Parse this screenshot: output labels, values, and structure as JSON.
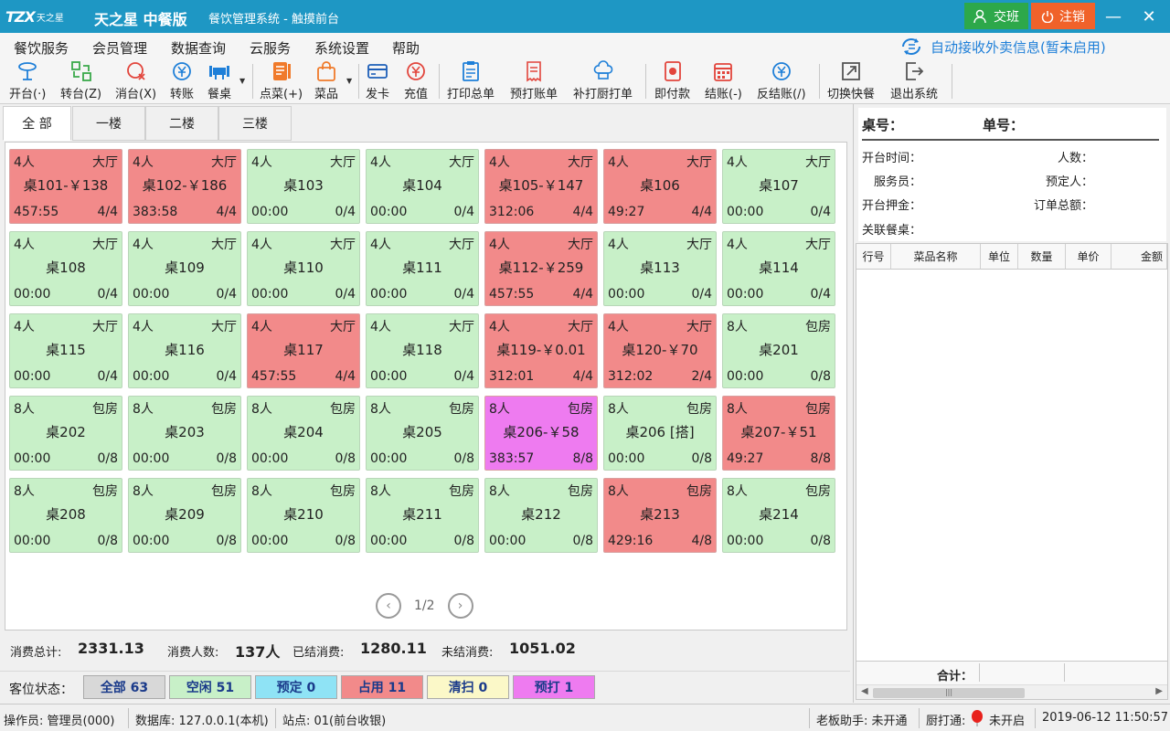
{
  "titlebar": {
    "logo_mark": "TZX",
    "logo_text": "天之星",
    "app_title": "天之星 中餐版",
    "window_title": "餐饮管理系统 - 触摸前台",
    "shift_label": "交班",
    "logout_label": "注销",
    "minimize_glyph": "—",
    "close_glyph": "✕"
  },
  "menu": {
    "items": [
      "餐饮服务",
      "会员管理",
      "数据查询",
      "云服务",
      "系统设置",
      "帮助"
    ],
    "auto_receive": "自动接收外卖信息(暂未启用)"
  },
  "toolbar": {
    "tools": [
      {
        "label": "开台(·)",
        "icon": "open-table-icon"
      },
      {
        "label": "转台(Z)",
        "icon": "transfer-table-icon"
      },
      {
        "label": "消台(X)",
        "icon": "cancel-table-icon"
      },
      {
        "label": "转账",
        "icon": "transfer-bill-icon"
      },
      {
        "label": "餐桌",
        "icon": "dining-table-icon"
      },
      {
        "label": "点菜(+)",
        "icon": "order-dish-icon"
      },
      {
        "label": "菜品",
        "icon": "dishes-bag-icon"
      },
      {
        "label": "发卡",
        "icon": "issue-card-icon"
      },
      {
        "label": "充值",
        "icon": "recharge-icon"
      },
      {
        "label": "打印总单",
        "icon": "print-total-icon"
      },
      {
        "label": "预打账单",
        "icon": "preprint-bill-icon"
      },
      {
        "label": "补打厨打单",
        "icon": "reprint-kitchen-icon"
      },
      {
        "label": "即付款",
        "icon": "instant-pay-icon"
      },
      {
        "label": "结账(-)",
        "icon": "checkout-icon"
      },
      {
        "label": "反结账(/)",
        "icon": "reverse-checkout-icon"
      },
      {
        "label": "切换快餐",
        "icon": "switch-fastfood-icon"
      },
      {
        "label": "退出系统",
        "icon": "exit-icon"
      }
    ]
  },
  "tabs": [
    "全 部",
    "一楼",
    "二楼",
    "三楼"
  ],
  "colors": {
    "free": "#c8f0c8",
    "occupied": "#f28a8a",
    "preprint": "#ee7bf0",
    "reserved": "#8fe3f5",
    "cleaning": "#fbf8c8",
    "all": "#d8d8d8",
    "accent": "#1e97c4"
  },
  "tables": [
    {
      "cap": "4人",
      "area": "大厅",
      "name": "桌101-￥138",
      "time": "457:55",
      "occ": "4/4",
      "status": "occupied"
    },
    {
      "cap": "4人",
      "area": "大厅",
      "name": "桌102-￥186",
      "time": "383:58",
      "occ": "4/4",
      "status": "occupied"
    },
    {
      "cap": "4人",
      "area": "大厅",
      "name": "桌103",
      "time": "00:00",
      "occ": "0/4",
      "status": "free"
    },
    {
      "cap": "4人",
      "area": "大厅",
      "name": "桌104",
      "time": "00:00",
      "occ": "0/4",
      "status": "free"
    },
    {
      "cap": "4人",
      "area": "大厅",
      "name": "桌105-￥147",
      "time": "312:06",
      "occ": "4/4",
      "status": "occupied"
    },
    {
      "cap": "4人",
      "area": "大厅",
      "name": "桌106",
      "time": "49:27",
      "occ": "4/4",
      "status": "occupied"
    },
    {
      "cap": "4人",
      "area": "大厅",
      "name": "桌107",
      "time": "00:00",
      "occ": "0/4",
      "status": "free"
    },
    {
      "cap": "4人",
      "area": "大厅",
      "name": "桌108",
      "time": "00:00",
      "occ": "0/4",
      "status": "free"
    },
    {
      "cap": "4人",
      "area": "大厅",
      "name": "桌109",
      "time": "00:00",
      "occ": "0/4",
      "status": "free"
    },
    {
      "cap": "4人",
      "area": "大厅",
      "name": "桌110",
      "time": "00:00",
      "occ": "0/4",
      "status": "free"
    },
    {
      "cap": "4人",
      "area": "大厅",
      "name": "桌111",
      "time": "00:00",
      "occ": "0/4",
      "status": "free"
    },
    {
      "cap": "4人",
      "area": "大厅",
      "name": "桌112-￥259",
      "time": "457:55",
      "occ": "4/4",
      "status": "occupied"
    },
    {
      "cap": "4人",
      "area": "大厅",
      "name": "桌113",
      "time": "00:00",
      "occ": "0/4",
      "status": "free"
    },
    {
      "cap": "4人",
      "area": "大厅",
      "name": "桌114",
      "time": "00:00",
      "occ": "0/4",
      "status": "free"
    },
    {
      "cap": "4人",
      "area": "大厅",
      "name": "桌115",
      "time": "00:00",
      "occ": "0/4",
      "status": "free"
    },
    {
      "cap": "4人",
      "area": "大厅",
      "name": "桌116",
      "time": "00:00",
      "occ": "0/4",
      "status": "free"
    },
    {
      "cap": "4人",
      "area": "大厅",
      "name": "桌117",
      "time": "457:55",
      "occ": "4/4",
      "status": "occupied"
    },
    {
      "cap": "4人",
      "area": "大厅",
      "name": "桌118",
      "time": "00:00",
      "occ": "0/4",
      "status": "free"
    },
    {
      "cap": "4人",
      "area": "大厅",
      "name": "桌119-￥0.01",
      "time": "312:01",
      "occ": "4/4",
      "status": "occupied"
    },
    {
      "cap": "4人",
      "area": "大厅",
      "name": "桌120-￥70",
      "time": "312:02",
      "occ": "2/4",
      "status": "occupied"
    },
    {
      "cap": "8人",
      "area": "包房",
      "name": "桌201",
      "time": "00:00",
      "occ": "0/8",
      "status": "free"
    },
    {
      "cap": "8人",
      "area": "包房",
      "name": "桌202",
      "time": "00:00",
      "occ": "0/8",
      "status": "free"
    },
    {
      "cap": "8人",
      "area": "包房",
      "name": "桌203",
      "time": "00:00",
      "occ": "0/8",
      "status": "free"
    },
    {
      "cap": "8人",
      "area": "包房",
      "name": "桌204",
      "time": "00:00",
      "occ": "0/8",
      "status": "free"
    },
    {
      "cap": "8人",
      "area": "包房",
      "name": "桌205",
      "time": "00:00",
      "occ": "0/8",
      "status": "free"
    },
    {
      "cap": "8人",
      "area": "包房",
      "name": "桌206-￥58",
      "time": "383:57",
      "occ": "8/8",
      "status": "preprint"
    },
    {
      "cap": "8人",
      "area": "包房",
      "name": "桌206 [搭]",
      "time": "00:00",
      "occ": "0/8",
      "status": "free"
    },
    {
      "cap": "8人",
      "area": "包房",
      "name": "桌207-￥51",
      "time": "49:27",
      "occ": "8/8",
      "status": "occupied"
    },
    {
      "cap": "8人",
      "area": "包房",
      "name": "桌208",
      "time": "00:00",
      "occ": "0/8",
      "status": "free"
    },
    {
      "cap": "8人",
      "area": "包房",
      "name": "桌209",
      "time": "00:00",
      "occ": "0/8",
      "status": "free"
    },
    {
      "cap": "8人",
      "area": "包房",
      "name": "桌210",
      "time": "00:00",
      "occ": "0/8",
      "status": "free"
    },
    {
      "cap": "8人",
      "area": "包房",
      "name": "桌211",
      "time": "00:00",
      "occ": "0/8",
      "status": "free"
    },
    {
      "cap": "8人",
      "area": "包房",
      "name": "桌212",
      "time": "00:00",
      "occ": "0/8",
      "status": "free"
    },
    {
      "cap": "8人",
      "area": "包房",
      "name": "桌213",
      "time": "429:16",
      "occ": "4/8",
      "status": "occupied"
    },
    {
      "cap": "8人",
      "area": "包房",
      "name": "桌214",
      "time": "00:00",
      "occ": "0/8",
      "status": "free"
    }
  ],
  "pager": {
    "text": "1/2",
    "prev_glyph": "‹",
    "next_glyph": "›"
  },
  "summary": {
    "total_label": "消费总计:",
    "total_value": "2331.13",
    "people_label": "消费人数:",
    "people_value": "137人",
    "settled_label": "已结消费:",
    "settled_value": "1280.11",
    "unsettled_label": "未结消费:",
    "unsettled_value": "1051.02"
  },
  "legend": {
    "title": "客位状态：",
    "items": [
      {
        "label": "全部 63",
        "key": "all"
      },
      {
        "label": "空闲 51",
        "key": "free"
      },
      {
        "label": "预定 0",
        "key": "reserved"
      },
      {
        "label": "占用 11",
        "key": "occupied"
      },
      {
        "label": "清扫 0",
        "key": "cleaning"
      },
      {
        "label": "预打 1",
        "key": "preprint"
      }
    ]
  },
  "detail": {
    "table_no": "桌号：",
    "order_no": "单号：",
    "open_time": "开台时间：",
    "people": "人数：",
    "waiter": "服务员：",
    "reserver": "预定人：",
    "deposit": "开台押金：",
    "order_total": "订单总额：",
    "linked": "关联餐桌："
  },
  "order_table": {
    "columns": [
      "行号",
      "菜品名称",
      "单位",
      "数量",
      "单价",
      "金额"
    ],
    "footer_label": "合计："
  },
  "statusbar": {
    "operator": "操作员: 管理员(000)",
    "database": "数据库: 127.0.0.1(本机)",
    "station": "站点: 01(前台收银)",
    "boss": "老板助手: 未开通",
    "kitchen_label": "厨打通:",
    "kitchen_status": "未开启",
    "datetime": "2019-06-12 11:50:57"
  }
}
